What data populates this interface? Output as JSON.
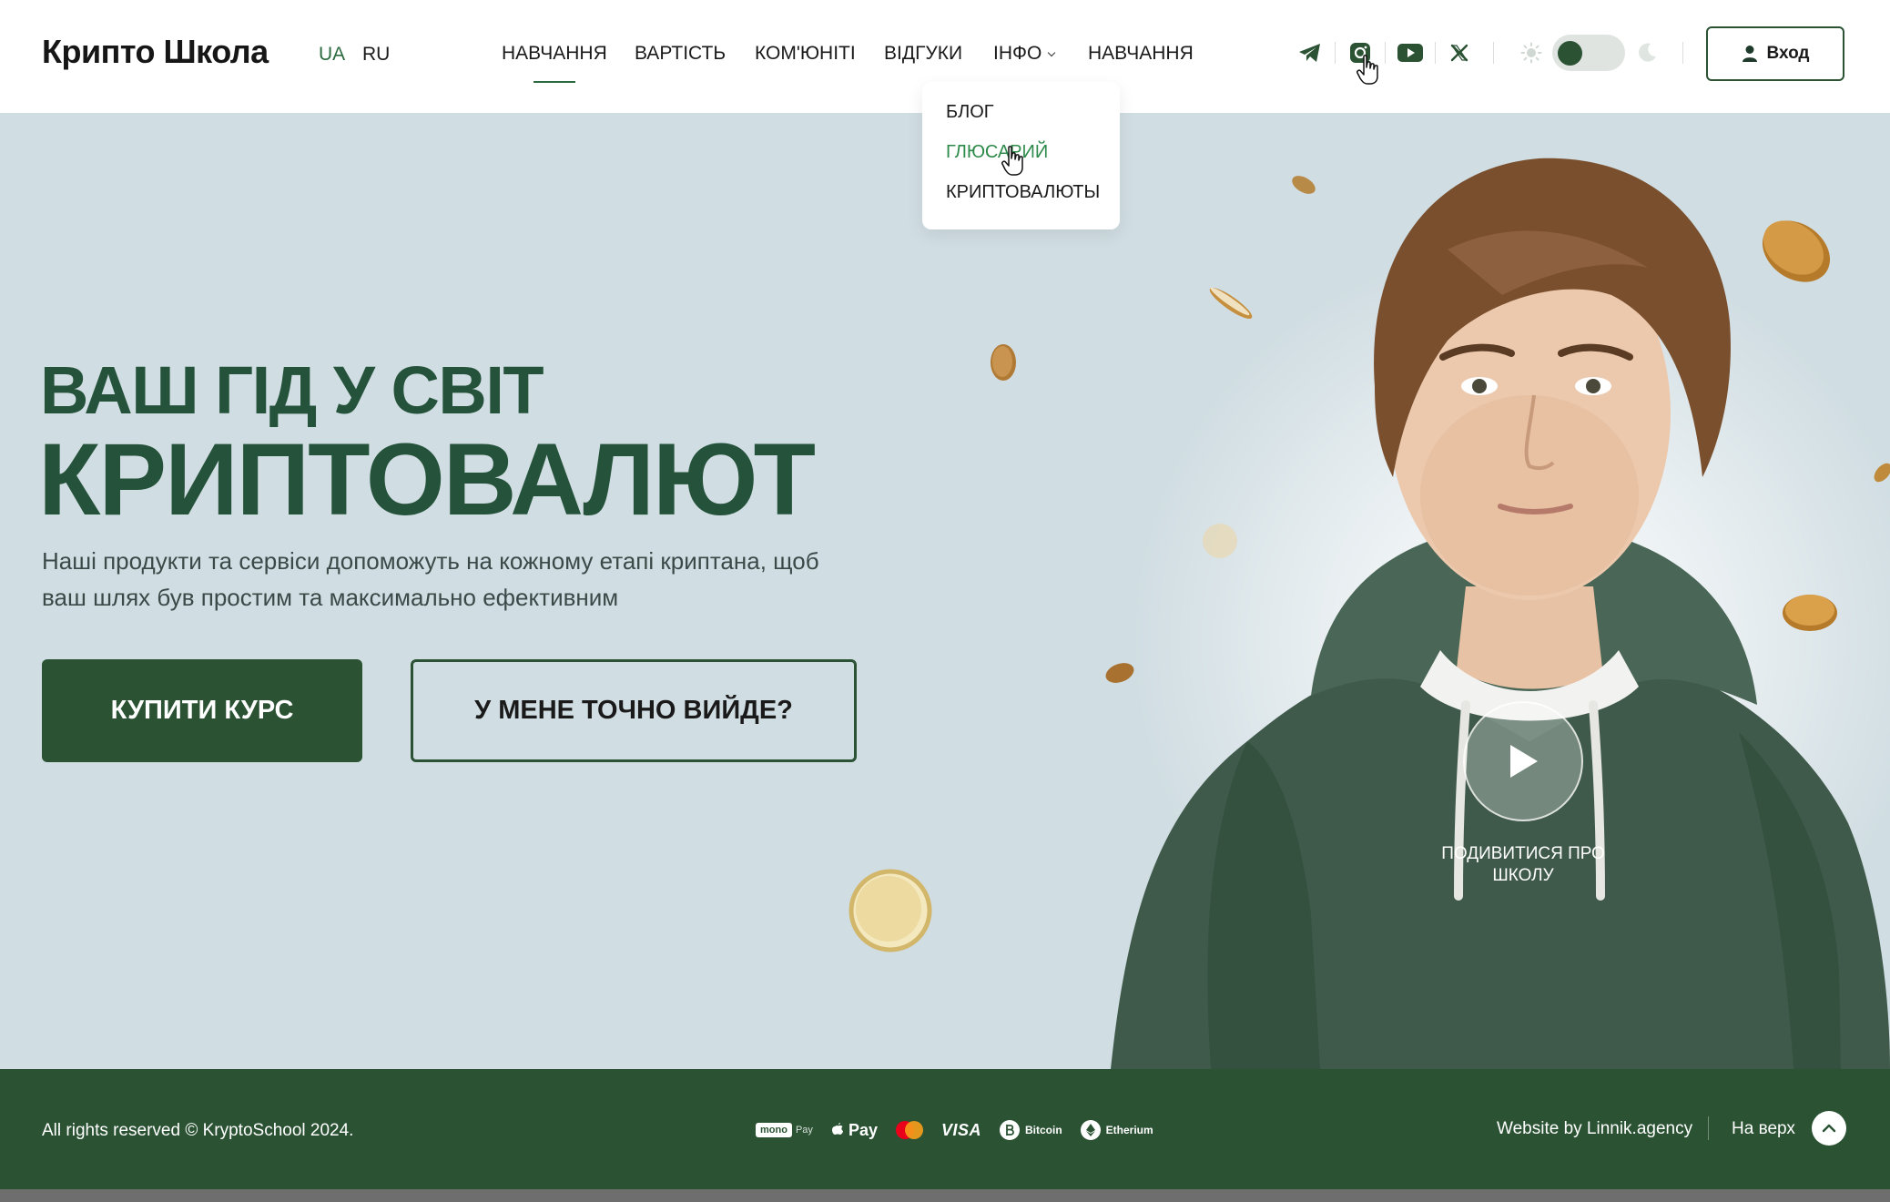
{
  "header": {
    "logo": "Крипто Школа",
    "languages": [
      "UA",
      "RU"
    ],
    "nav": [
      "НАВЧАННЯ",
      "ВАРТІСТЬ",
      "КОМ'ЮНІТІ",
      "ВІДГУКИ",
      "ІНФО",
      "НАВЧАННЯ"
    ],
    "login_label": "Вход"
  },
  "dropdown": {
    "items": [
      "БЛОГ",
      "ГЛЮСАРИЙ",
      "КРИПТОВАЛЮТЫ"
    ]
  },
  "hero": {
    "title_line1": "ВАШ ГІД У СВІТ",
    "title_line2": "КРИПТОВАЛЮТ",
    "subtitle": "Наші продукти та сервіси допоможуть на кожному етапі криптана, щоб ваш шлях був простим та максимально ефективним",
    "buy_button": "КУПИТИ КУРС",
    "secondary_button": "У МЕНЕ ТОЧНО ВИЙДЕ?",
    "video_label": "ПОДИВИТИСЯ ПРО ШКОЛУ"
  },
  "footer": {
    "copyright": "All rights reserved © KryptoSchool 2024.",
    "payments": {
      "mono": "mono",
      "mono_pay": "Pay",
      "apple_pay": "Pay",
      "visa": "VISA",
      "bitcoin": "Bitcoin",
      "etherium": "Etherium"
    },
    "credit": "Website by Linnik.agency",
    "to_top": "На верх"
  },
  "colors": {
    "brand_green": "#2a5233",
    "accent_green": "#2e8a4a",
    "hero_bg": "#d0dde2"
  },
  "icons": [
    "telegram-icon",
    "instagram-icon",
    "youtube-icon",
    "x-icon",
    "sun-icon",
    "moon-icon",
    "user-icon",
    "play-icon",
    "chevron-up-icon"
  ]
}
